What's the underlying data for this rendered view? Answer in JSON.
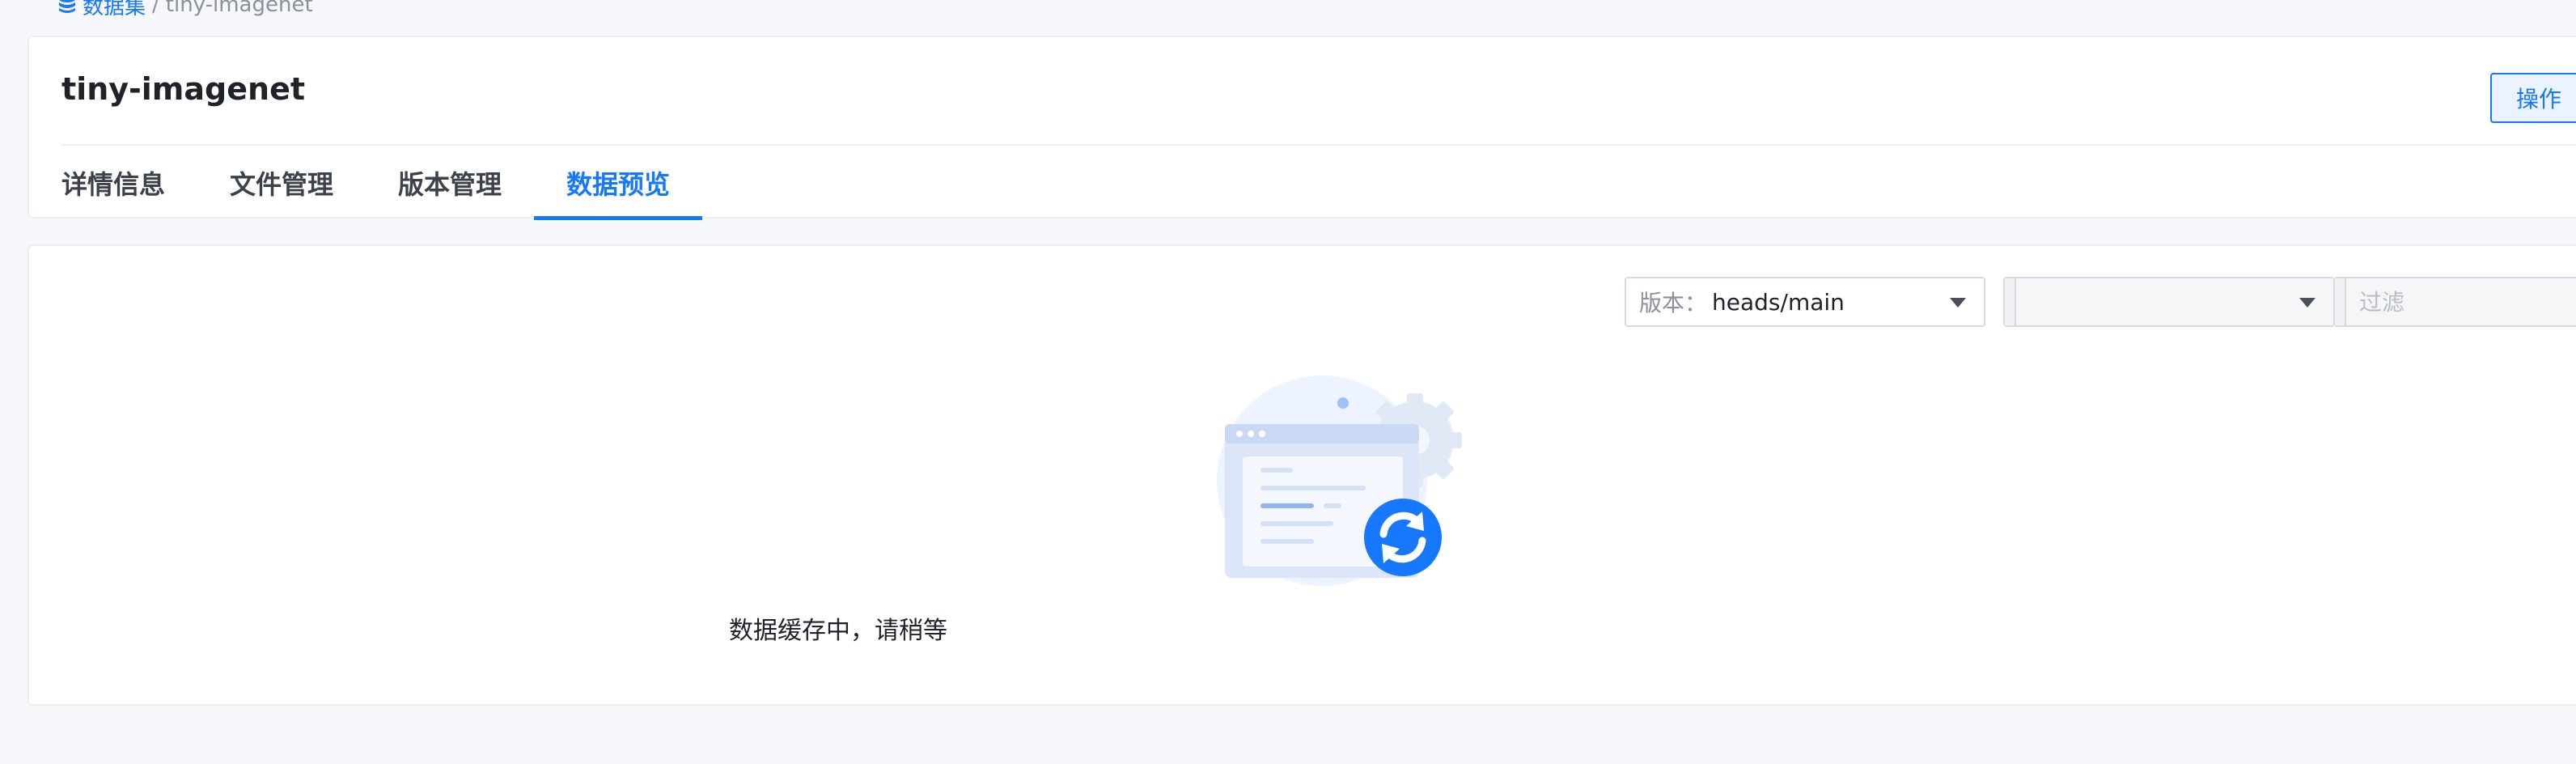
{
  "breadcrumb": {
    "root_label": "数据集",
    "separator": "/",
    "current": "tiny-imagenet"
  },
  "header": {
    "title": "tiny-imagenet",
    "action_label": "操作"
  },
  "tabs": [
    {
      "label": "详情信息",
      "active": false
    },
    {
      "label": "文件管理",
      "active": false
    },
    {
      "label": "版本管理",
      "active": false
    },
    {
      "label": "数据预览",
      "active": true
    }
  ],
  "toolbar": {
    "version_label": "版本：",
    "version_value": "heads/main",
    "field_select_value": "",
    "filter_placeholder": "过滤"
  },
  "empty_state": {
    "message": "数据缓存中，请稍等",
    "icon": "refresh-icon"
  },
  "colors": {
    "accent": "#1677ff",
    "background": "#f6f7fb",
    "card": "#ffffff"
  }
}
